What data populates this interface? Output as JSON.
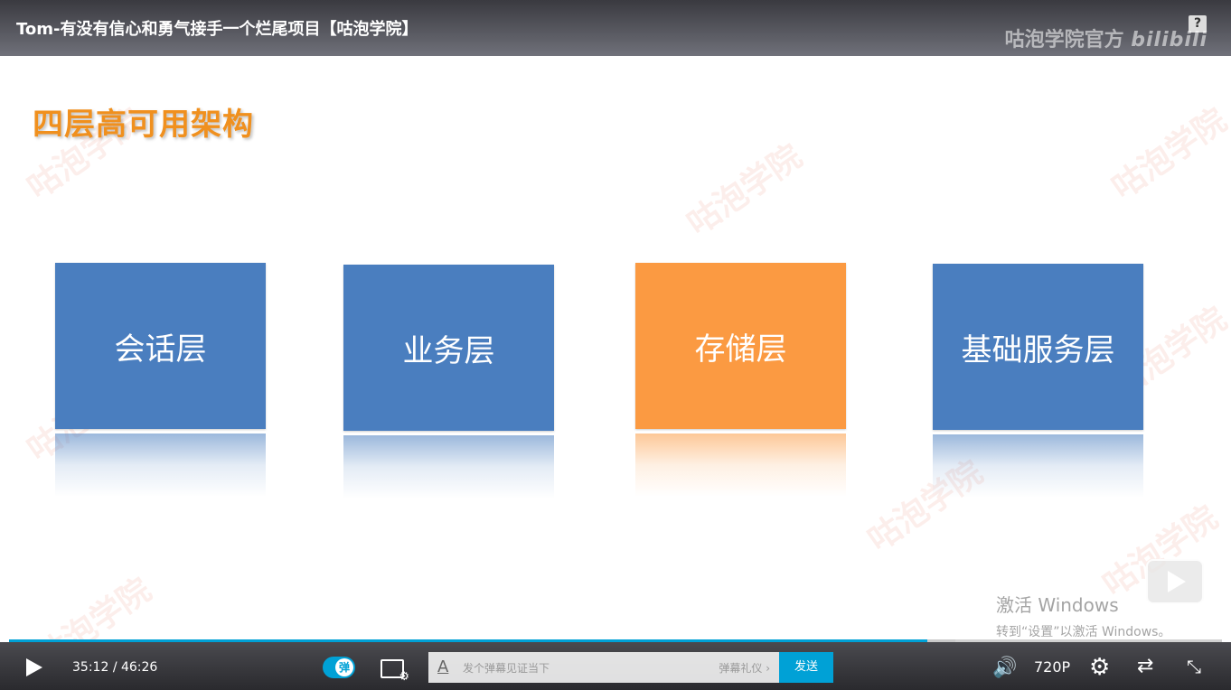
{
  "header": {
    "title": "Tom-有没有信心和勇气接手一个烂尾项目【咕泡学院】",
    "brand": "咕泡学院官方",
    "brand_mark": "bilibili",
    "help": "?"
  },
  "slide": {
    "title": "四层高可用架构",
    "layers": [
      {
        "label": "会话层",
        "color": "#4a7ebf"
      },
      {
        "label": "业务层",
        "color": "#4a7ebf"
      },
      {
        "label": "存储层",
        "color": "#fb9a42"
      },
      {
        "label": "基础服务层",
        "color": "#4a7ebf"
      }
    ],
    "watermark": "咕泡学院"
  },
  "overlay": {
    "activate_line1": "激活 Windows",
    "activate_line2": "转到“设置”以激活 Windows。"
  },
  "controls": {
    "current_time": "35:12",
    "separator": "/",
    "total_time": "46:26",
    "played_fraction": 0.757,
    "buffered_fraction": 0.78,
    "danmaku_toggle": "弹",
    "danmaku_placeholder": "发个弹幕见证当下",
    "danmaku_etiquette": "弹幕礼仪 ›",
    "send_label": "发送",
    "quality": "720P",
    "accent_color": "#00a1d6"
  }
}
